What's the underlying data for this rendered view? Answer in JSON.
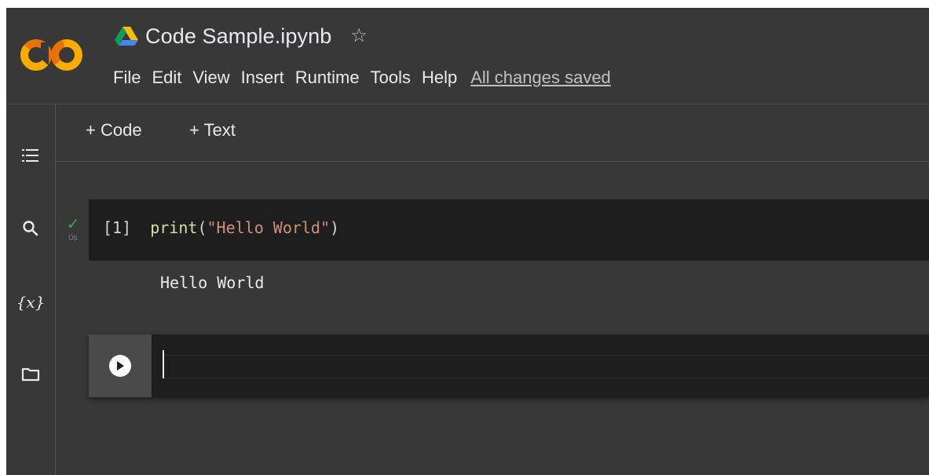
{
  "app": {
    "logo_icon": "colab-logo-icon"
  },
  "header": {
    "doc_title": "Code Sample.ipynb",
    "drive_icon": "google-drive-icon",
    "star_icon": "star-outline-icon",
    "star_glyph": "☆",
    "menu": [
      {
        "label": "File"
      },
      {
        "label": "Edit"
      },
      {
        "label": "View"
      },
      {
        "label": "Insert"
      },
      {
        "label": "Runtime"
      },
      {
        "label": "Tools"
      },
      {
        "label": "Help"
      }
    ],
    "save_status": "All changes saved"
  },
  "sidebar": {
    "items": [
      {
        "icon": "table-of-contents-icon"
      },
      {
        "icon": "search-icon"
      },
      {
        "icon": "variables-icon",
        "glyph": "{x}"
      },
      {
        "icon": "folder-icon"
      }
    ]
  },
  "toolbar": {
    "add_code_label": "+ Code",
    "add_text_label": "+ Text"
  },
  "cells": [
    {
      "type": "code",
      "exec_count": "[1]",
      "status_icon": "check-icon",
      "status_glyph": "✓",
      "exec_time": "0s",
      "code_fn": "print",
      "code_open": "(",
      "code_string": "\"Hello World\"",
      "code_close": ")",
      "output": "Hello World"
    },
    {
      "type": "code",
      "run_icon": "play-icon",
      "content": ""
    }
  ],
  "colors": {
    "background": "#383838",
    "cell_background": "#1e1e1e",
    "logo_orange": "#F9AB00",
    "logo_dark_orange": "#E8710A",
    "success_green": "#34a853",
    "string_color": "#ce9178",
    "function_color": "#dcdcaa"
  }
}
